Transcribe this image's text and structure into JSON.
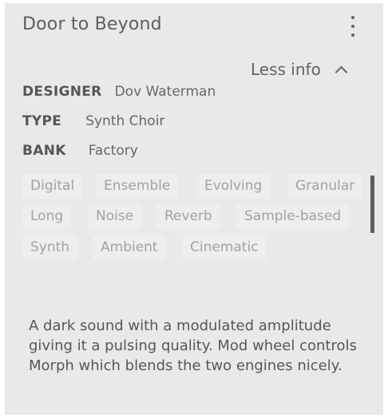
{
  "preset": {
    "title": "Door to Beyond",
    "menu_icon": "more-vertical-icon"
  },
  "info_toggle": {
    "label": "Less info",
    "icon": "chevron-up-icon"
  },
  "meta": {
    "designer_key": "DESIGNER",
    "designer_value": "Dov Waterman",
    "type_key": "TYPE",
    "type_value": "Synth Choir",
    "bank_key": "BANK",
    "bank_value": "Factory"
  },
  "tags": [
    "Digital",
    "Ensemble",
    "Evolving",
    "Granular",
    "Long",
    "Noise",
    "Reverb",
    "Sample-based",
    "Synth",
    "Ambient",
    "Cinematic"
  ],
  "description": "A dark sound with a modulated amplitude giving it a pulsing quality. Mod wheel controls Morph which blends the two engines nicely.",
  "colors": {
    "panel_bg": "#e9e9e8",
    "tag_bg": "#eeeeed",
    "tag_text": "#a2a2a2",
    "scrollbar": "#5c5c5c"
  }
}
